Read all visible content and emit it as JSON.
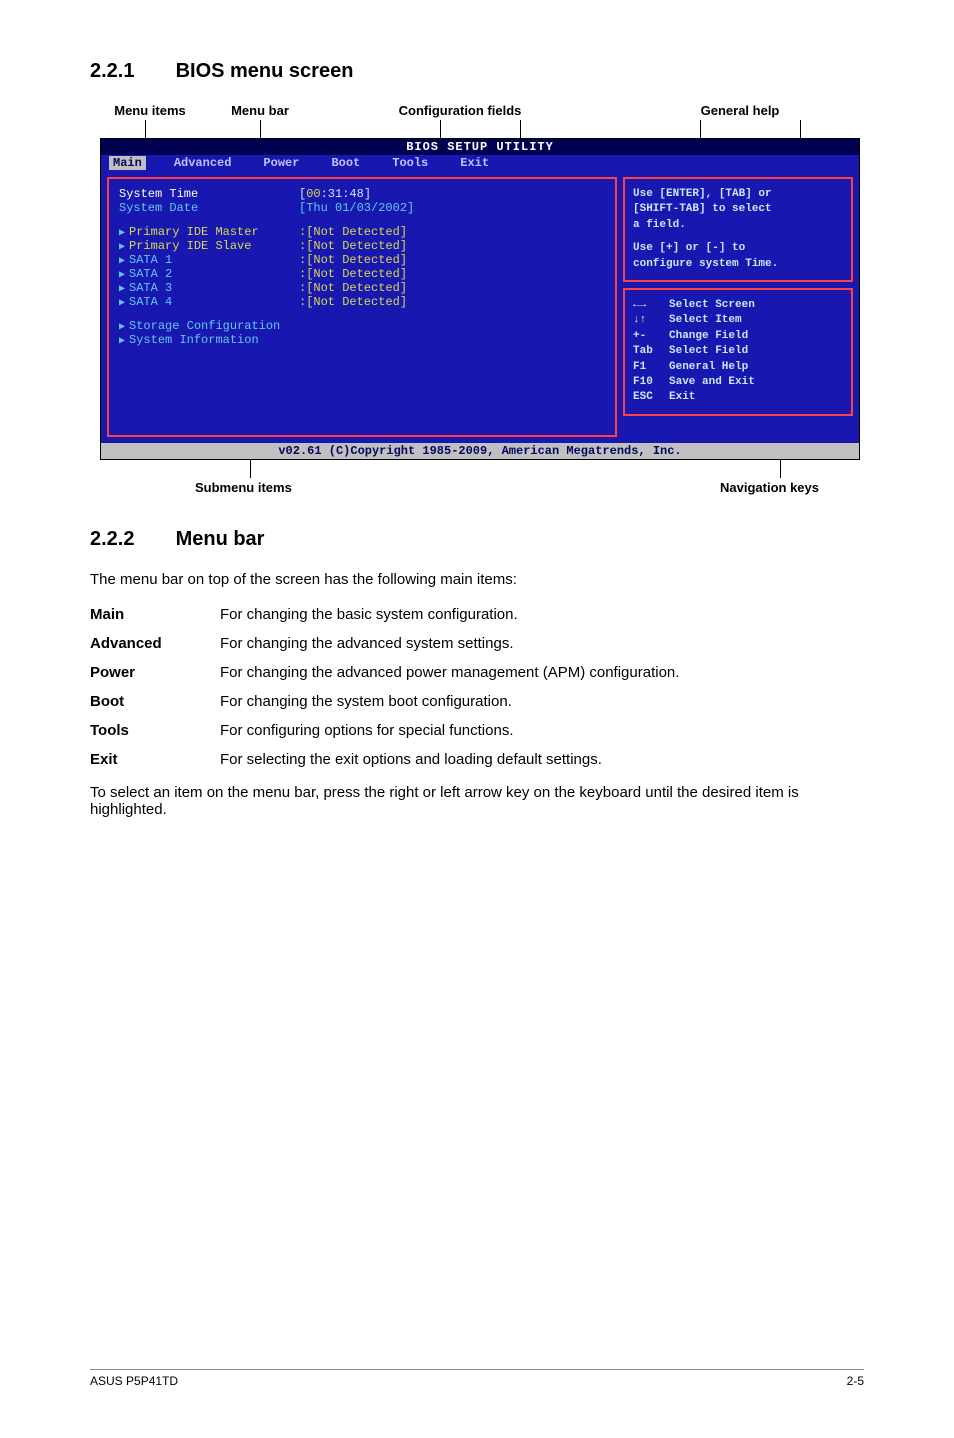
{
  "headings": {
    "s221_num": "2.2.1",
    "s221_title": "BIOS menu screen",
    "s222_num": "2.2.2",
    "s222_title": "Menu bar"
  },
  "top_labels": {
    "menu_items": "Menu items",
    "menu_bar": "Menu bar",
    "config_fields": "Configuration fields",
    "general_help": "General help"
  },
  "bottom_labels": {
    "submenu_items": "Submenu items",
    "nav_keys": "Navigation keys"
  },
  "bios": {
    "title": "BIOS SETUP UTILITY",
    "tabs": [
      "Main",
      "Advanced",
      "Power",
      "Boot",
      "Tools",
      "Exit"
    ],
    "rows": {
      "system_time_k": "System Time",
      "system_time_v_pre": "[",
      "system_time_hh": "00",
      "system_time_v_post": ":31:48]",
      "system_date_k": "System Date",
      "system_date_v": "[Thu 01/03/2002]",
      "pide_master": "Primary IDE Master",
      "pide_slave": "Primary IDE Slave",
      "sata1": "SATA 1",
      "sata2": "SATA 2",
      "sata3": "SATA 3",
      "sata4": "SATA 4",
      "nd": ":[Not Detected]",
      "storage_cfg": "Storage Configuration",
      "sys_info": "System Information"
    },
    "help1_l1": "Use [ENTER], [TAB] or",
    "help1_l2": "[SHIFT-TAB] to select",
    "help1_l3": "a field.",
    "help1_l4": "Use [+] or [-] to",
    "help1_l5": "configure system Time.",
    "keys": [
      [
        "←→",
        "Select Screen"
      ],
      [
        "↓↑",
        "Select Item"
      ],
      [
        "+-",
        "Change Field"
      ],
      [
        "Tab",
        "Select Field"
      ],
      [
        "F1",
        "General Help"
      ],
      [
        "F10",
        "Save and Exit"
      ],
      [
        "ESC",
        "Exit"
      ]
    ],
    "footer": "v02.61 (C)Copyright 1985-2009, American Megatrends, Inc."
  },
  "menubar_intro": "The menu bar on top of the screen has the following main items:",
  "defs": [
    [
      "Main",
      "For changing the basic system configuration."
    ],
    [
      "Advanced",
      "For changing the advanced system settings."
    ],
    [
      "Power",
      "For changing the advanced power management (APM) configuration."
    ],
    [
      "Boot",
      "For changing the system boot configuration."
    ],
    [
      "Tools",
      "For configuring options for special functions."
    ],
    [
      "Exit",
      "For selecting the exit options and loading default settings."
    ]
  ],
  "menubar_outro": "To select an item on the menu bar, press the right or left arrow key on the keyboard until the desired item is highlighted.",
  "footer": {
    "left": "ASUS P5P41TD",
    "right": "2-5"
  }
}
